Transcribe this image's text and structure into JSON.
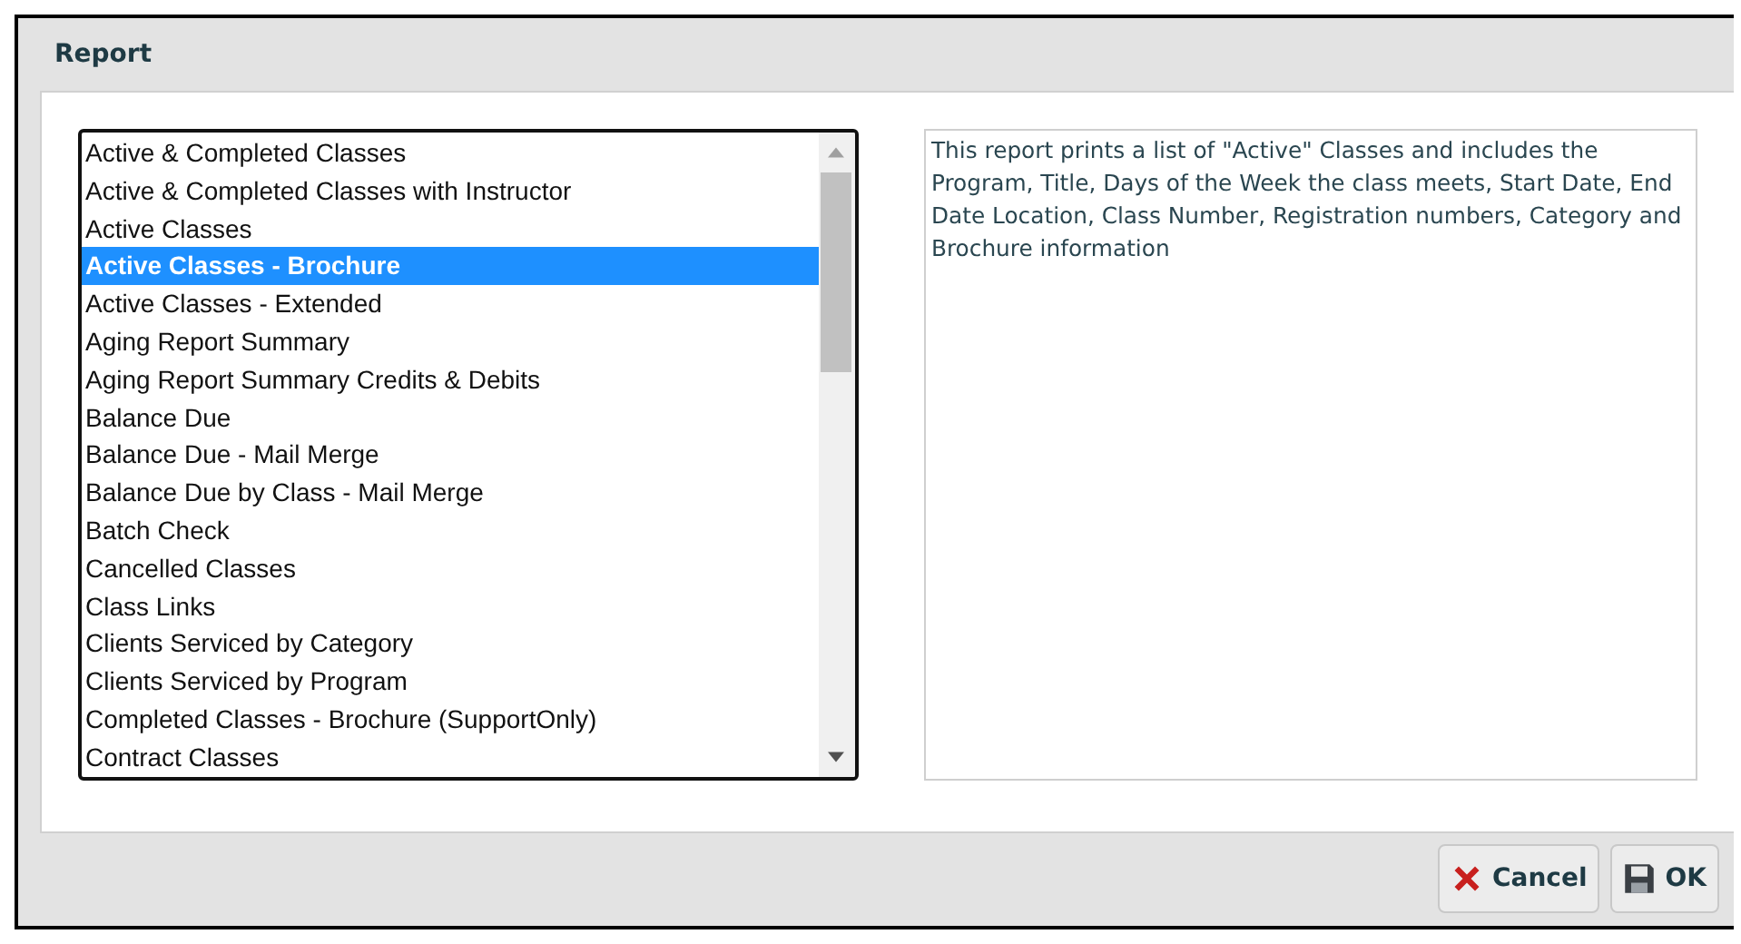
{
  "dialog": {
    "title": "Report"
  },
  "reports": [
    {
      "label": "Active & Completed Classes",
      "selected": false
    },
    {
      "label": "Active & Completed Classes with Instructor",
      "selected": false
    },
    {
      "label": "Active Classes",
      "selected": false
    },
    {
      "label": "Active Classes - Brochure",
      "selected": true
    },
    {
      "label": "Active Classes - Extended",
      "selected": false
    },
    {
      "label": "Aging Report Summary",
      "selected": false
    },
    {
      "label": "Aging Report Summary Credits & Debits",
      "selected": false
    },
    {
      "label": "Balance Due",
      "selected": false
    },
    {
      "label": "Balance Due - Mail Merge",
      "selected": false
    },
    {
      "label": "Balance Due by Class - Mail Merge",
      "selected": false
    },
    {
      "label": "Batch Check",
      "selected": false
    },
    {
      "label": "Cancelled Classes",
      "selected": false
    },
    {
      "label": "Class Links",
      "selected": false
    },
    {
      "label": "Clients Serviced by Category",
      "selected": false
    },
    {
      "label": "Clients Serviced by Program",
      "selected": false
    },
    {
      "label": "Completed Classes - Brochure (SupportOnly)",
      "selected": false
    },
    {
      "label": "Contract Classes",
      "selected": false
    }
  ],
  "description": "This report prints a list of \"Active\" Classes and includes the Program, Title, Days of the Week the class meets, Start Date, End Date Location, Class Number, Registration numbers, Category and Brochure information",
  "buttons": [
    {
      "kind": "cancel",
      "label": "Cancel"
    },
    {
      "kind": "ok",
      "label": "OK"
    }
  ]
}
